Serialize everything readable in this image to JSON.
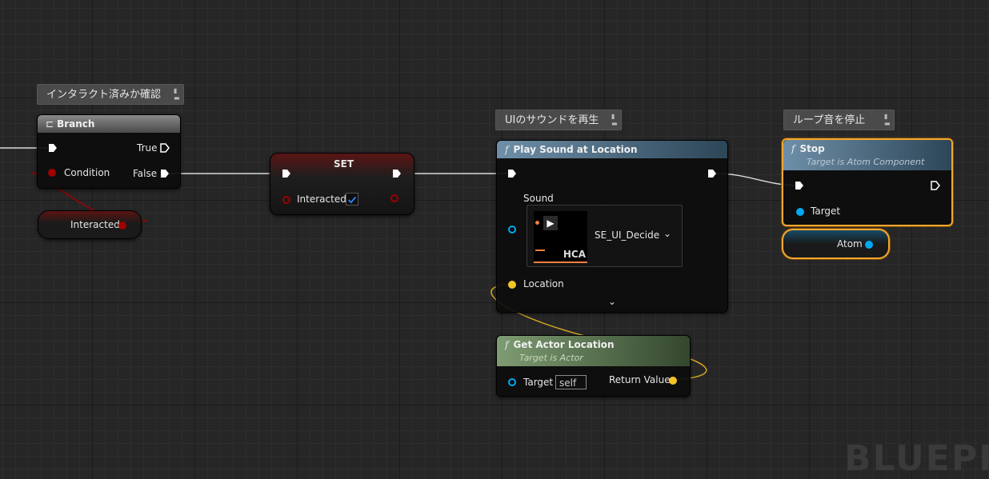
{
  "comments": {
    "branch": "インタラクト済みか確認",
    "play": "UIのサウンドを再生",
    "stop": "ループ音を停止"
  },
  "branch": {
    "title": "Branch",
    "pin_true": "True",
    "pin_false": "False",
    "pin_condition": "Condition"
  },
  "interacted_getter": {
    "label": "Interacted"
  },
  "set_node": {
    "title": "SET",
    "pin_label": "Interacted",
    "checked": true
  },
  "play_sound": {
    "title": "Play Sound at Location",
    "sound_label": "Sound",
    "asset_name": "SE_UI_Decide",
    "asset_badge": "HCA",
    "location_label": "Location"
  },
  "get_actor_location": {
    "title": "Get Actor Location",
    "subtitle": "Target is Actor",
    "target_label": "Target",
    "target_value": "self",
    "return_label": "Return Value"
  },
  "stop_node": {
    "title": "Stop",
    "subtitle": "Target is Atom Component",
    "target_label": "Target"
  },
  "atom_getter": {
    "label": "Atom"
  },
  "watermark": "BLUEPR",
  "colors": {
    "exec": "#ffffff",
    "bool": "#a00000",
    "object": "#00a8f0",
    "vector": "#f5c427",
    "selected": "#f3a72e"
  }
}
